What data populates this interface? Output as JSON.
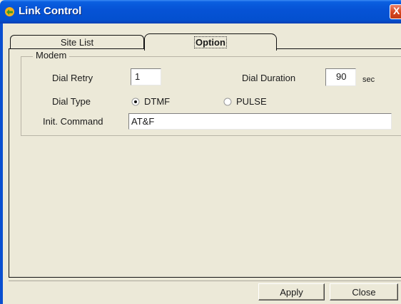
{
  "window": {
    "title": "Link Control",
    "close_glyph": "X"
  },
  "tabs": [
    {
      "label": "Site List",
      "active": false
    },
    {
      "label": "Option",
      "active": true
    }
  ],
  "modem": {
    "group_title": "Modem",
    "dial_retry": {
      "label": "Dial Retry",
      "value": "1"
    },
    "dial_duration": {
      "label": "Dial Duration",
      "value": "90",
      "unit": "sec"
    },
    "dial_type": {
      "label": "Dial Type",
      "options": [
        "DTMF",
        "PULSE"
      ],
      "selected": "DTMF"
    },
    "init_command": {
      "label": "Init. Command",
      "value": "AT&F"
    }
  },
  "buttons": {
    "apply": "Apply",
    "close": "Close"
  },
  "colors": {
    "titlebar": "#0653d6",
    "window_bg": "#ece9d8",
    "close_button": "#d6451d"
  }
}
